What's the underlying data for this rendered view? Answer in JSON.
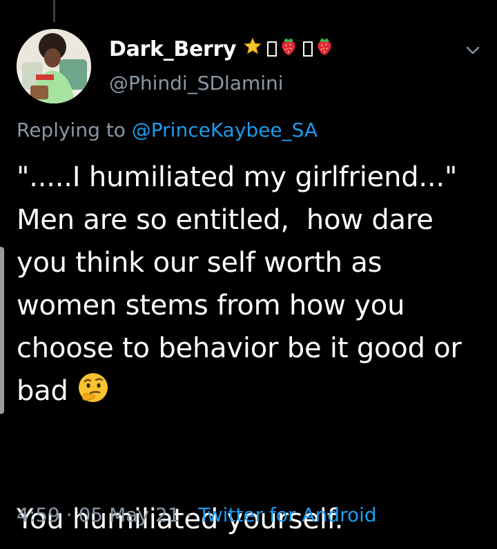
{
  "tweet": {
    "display_name": "Dark_Berry",
    "name_badges": [
      "star-icon",
      "tofu",
      "strawberry-icon",
      "tofu",
      "strawberry-icon"
    ],
    "handle": "@Phindi_SDlamini",
    "replying_prefix": "Replying to ",
    "replying_to": "@PrinceKaybee_SA",
    "text_main": "\".....I humiliated my girlfriend...\"\nMen are so entitled,  how dare you think our self worth as women stems from how you choose to behavior be it good or bad",
    "text_emoji": "thinking-face-emoji",
    "text_last": "You humiliated yourself.",
    "time": "4:59",
    "separator": " · ",
    "date": "05 May 21",
    "source": "Twitter for Android"
  },
  "colors": {
    "background": "#000000",
    "primary_text": "#ffffff",
    "secondary_text": "#8b98a5",
    "accent": "#1d9bf0"
  }
}
